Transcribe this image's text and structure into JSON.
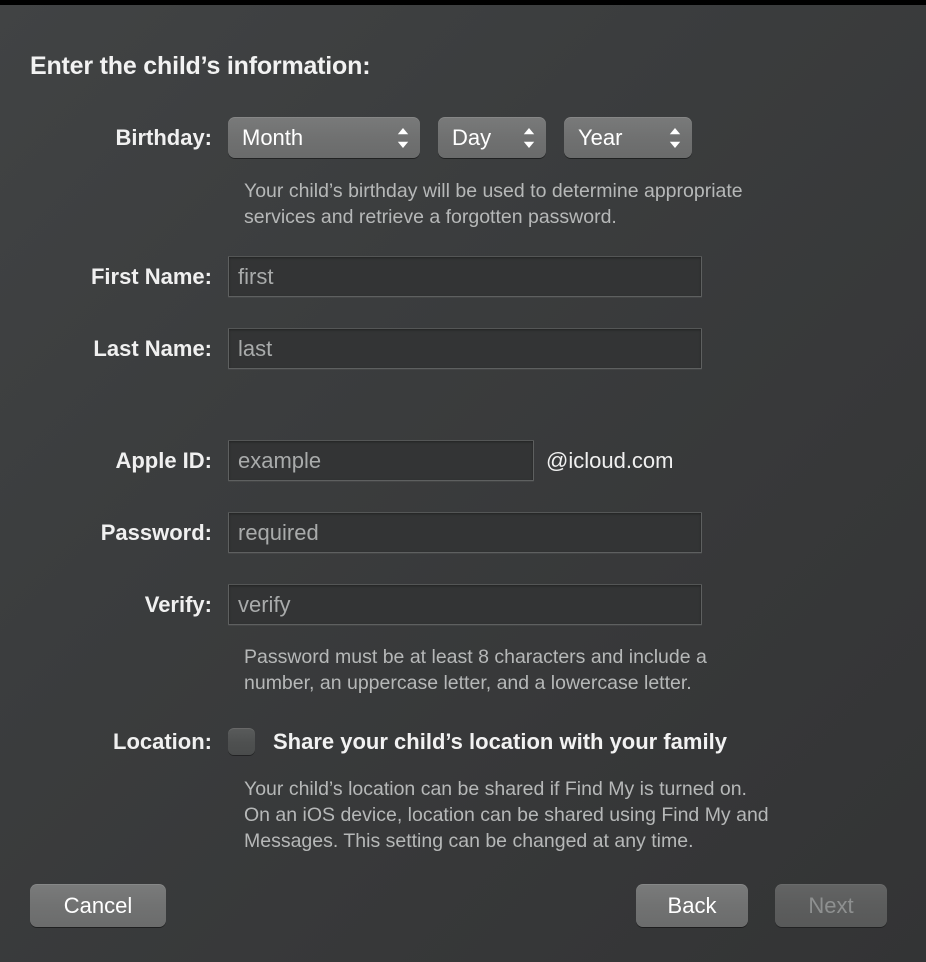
{
  "dialog": {
    "heading": "Enter the child’s information:"
  },
  "fields": {
    "birthday": {
      "label": "Birthday:",
      "month": {
        "value": "Month",
        "placeholder": "Month"
      },
      "day": {
        "value": "Day",
        "placeholder": "Day"
      },
      "year": {
        "value": "Year",
        "placeholder": "Year"
      },
      "helper": [
        "Your child’s birthday will be used to determine appropriate",
        "services and retrieve a forgotten password."
      ]
    },
    "first_name": {
      "label": "First Name:",
      "value": "",
      "placeholder": "first"
    },
    "last_name": {
      "label": "Last Name:",
      "value": "",
      "placeholder": "last"
    },
    "apple_id": {
      "label": "Apple ID:",
      "value": "",
      "placeholder": "example",
      "suffix": "@icloud.com"
    },
    "password": {
      "label": "Password:",
      "value": "",
      "placeholder": "required"
    },
    "verify": {
      "label": "Verify:",
      "value": "",
      "placeholder": "verify",
      "helper": [
        "Password must be at least 8 characters and include a",
        "number, an uppercase letter, and a lowercase letter."
      ]
    },
    "location": {
      "label": "Location:",
      "checkbox_label": "Share your child’s location with your family",
      "checked": false,
      "helper": [
        "Your child’s location can be shared if Find My is turned on.",
        "On an iOS device, location can be shared using Find My and",
        "Messages. This setting can be changed at any time."
      ]
    }
  },
  "buttons": {
    "cancel": "Cancel",
    "back": "Back",
    "next": "Next",
    "next_enabled": false
  },
  "icons": {
    "stepper": "stepper-up-down-chevron-icon"
  },
  "colors": {
    "background": "#3a3c3c",
    "control_fill": "#717272",
    "field_fill": "#333435",
    "text_primary": "#f2f2f2",
    "text_secondary": "#b6b8b8",
    "placeholder": "#a9abab",
    "disabled_text": "#8e9090"
  }
}
